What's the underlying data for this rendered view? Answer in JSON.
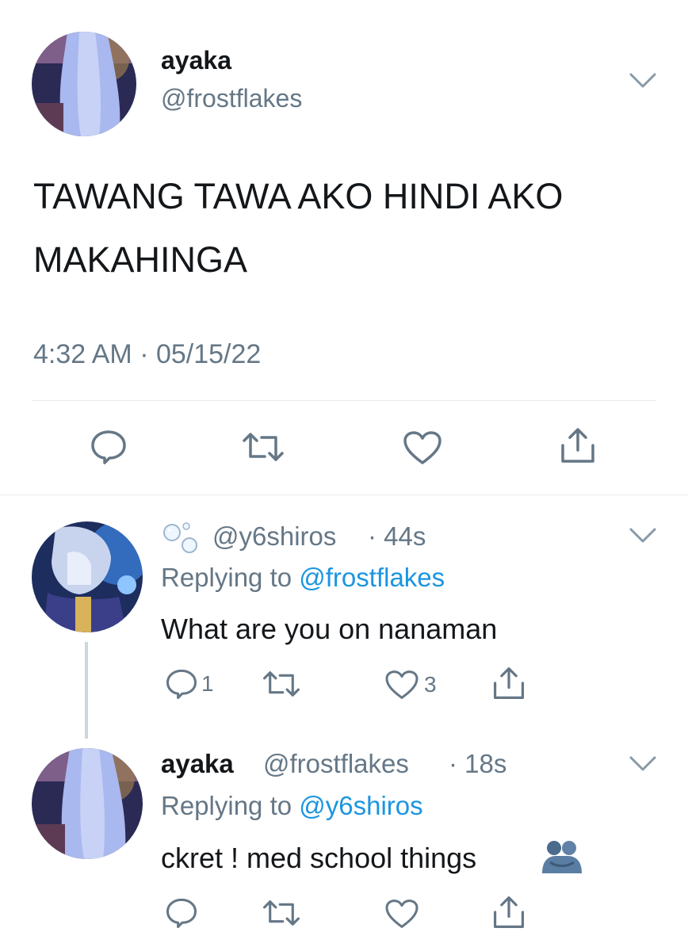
{
  "main_tweet": {
    "display_name": "ayaka",
    "handle": "@frostflakes",
    "text_line1": "TAWANG TAWA AKO HINDI AKO",
    "text_line2": "MAKAHINGA",
    "timestamp": "4:32 AM · 05/15/22"
  },
  "replies": [
    {
      "handle": "@y6shiros",
      "time": "· 44s",
      "replying_prefix": "Replying to ",
      "replying_to": "@frostflakes",
      "text": "What are you on nanaman",
      "reply_count": "1",
      "like_count": "3"
    },
    {
      "display_name": "ayaka",
      "handle": "@frostflakes",
      "time": "· 18s",
      "replying_prefix": "Replying to ",
      "replying_to": "@y6shiros",
      "text": "ckret ! med school things"
    }
  ],
  "colors": {
    "text": "#14171a",
    "muted": "#657786",
    "link": "#1b95e0",
    "divider": "#e6ecf0"
  },
  "icons": [
    "chevron-down-icon",
    "reply-icon",
    "retweet-icon",
    "like-icon",
    "share-icon",
    "bubbles-icon",
    "hugging-emoji"
  ]
}
